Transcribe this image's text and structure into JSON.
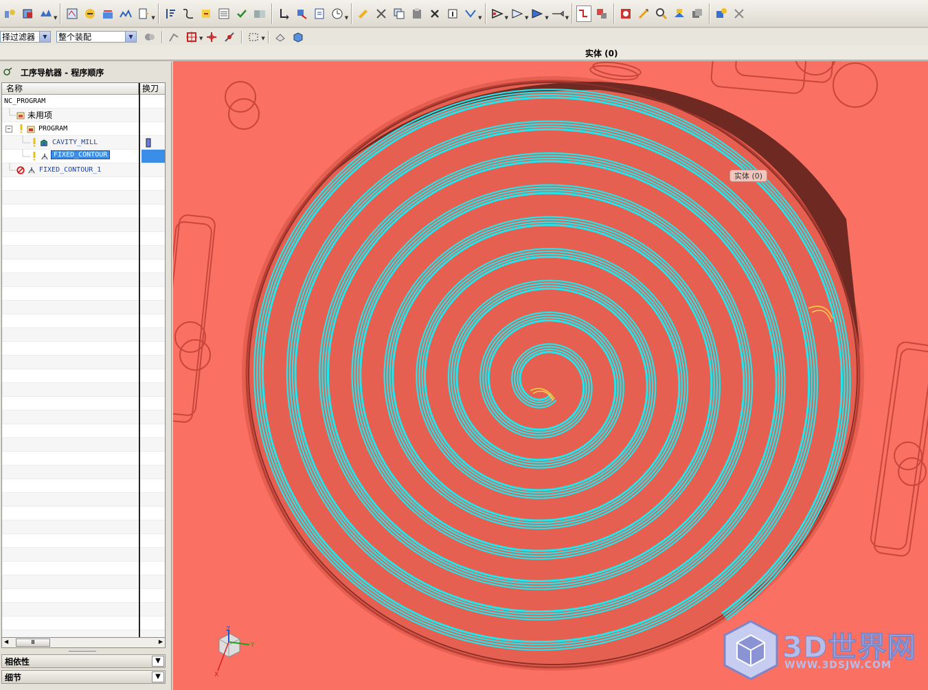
{
  "toolbar": {
    "sections": 7
  },
  "filter_bar": {
    "selection_filter": "择过滤器",
    "assembly_scope": "整个装配"
  },
  "status": {
    "selection_text": "实体 (0)"
  },
  "navigator": {
    "title": "工序导航器 - 程序顺序",
    "columns": {
      "name": "名称",
      "tool_change": "换刀"
    },
    "rows": [
      {
        "name": "NC_PROGRAM"
      },
      {
        "name": "未用项"
      },
      {
        "name": "PROGRAM"
      },
      {
        "name": "CAVITY_MILL"
      },
      {
        "name": "FIXED_CONTOUR"
      },
      {
        "name": "FIXED_CONTOUR_1"
      }
    ],
    "scroll_thumb": "Ⅲ"
  },
  "panels": {
    "dependencies": "相依性",
    "details": "细节"
  },
  "viewport": {
    "tooltip": "实体 (0)",
    "watermark_main": "3D世界网",
    "watermark_url": "WWW.3DSJW.COM",
    "colors": {
      "background": "#fa7062",
      "toolpath": "#1ee8ee",
      "wall": "#6e2a22"
    },
    "triad": {
      "x": "X",
      "y": "Y",
      "z": "Z"
    }
  }
}
